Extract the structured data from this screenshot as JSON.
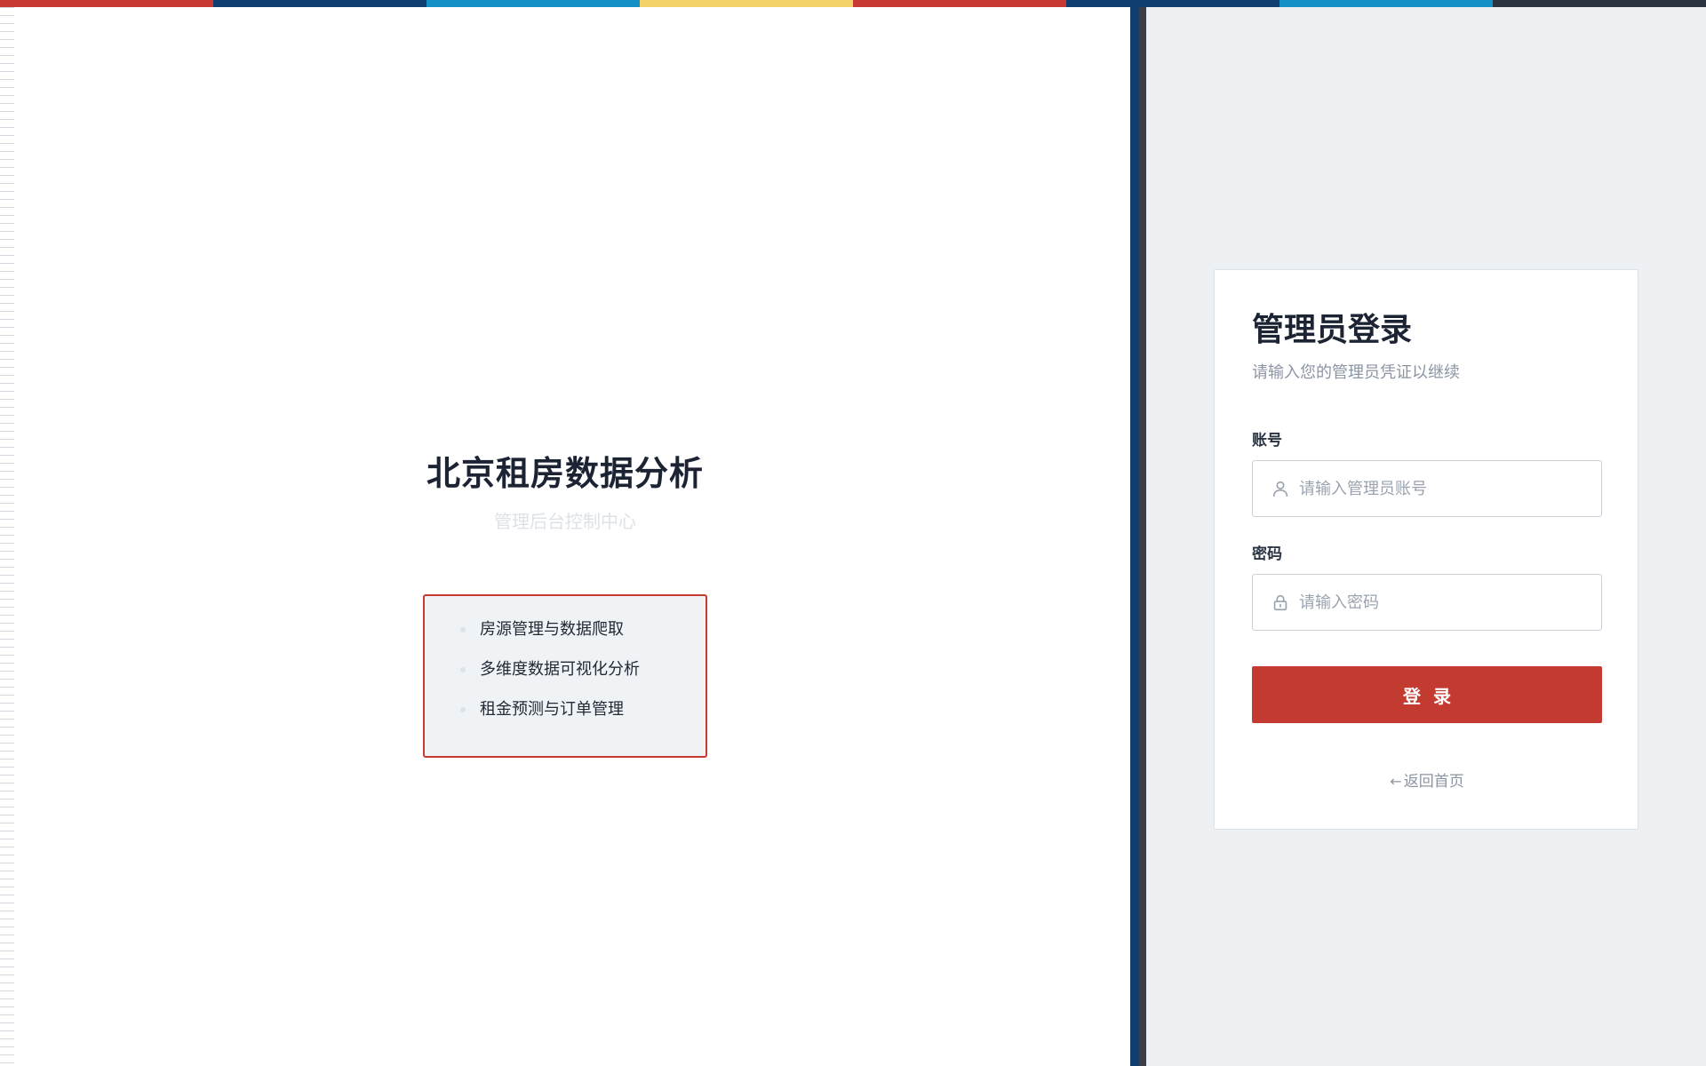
{
  "colors": {
    "stripe": [
      "#c83a31",
      "#0f3f70",
      "#1590c6",
      "#f3d26a",
      "#c83a31",
      "#0f3f70",
      "#1590c6",
      "#2a3440"
    ],
    "accent": "#c33a31",
    "divider": "#0f3f70",
    "right_bg": "#eef1f4"
  },
  "hero": {
    "title": "北京租房数据分析",
    "subtitle": "管理后台控制中心",
    "features": [
      "房源管理与数据爬取",
      "多维度数据可视化分析",
      "租金预测与订单管理"
    ]
  },
  "login": {
    "title": "管理员登录",
    "subtitle": "请输入您的管理员凭证以继续",
    "account": {
      "label": "账号",
      "placeholder": "请输入管理员账号",
      "icon": "user-icon"
    },
    "password": {
      "label": "密码",
      "placeholder": "请输入密码",
      "icon": "lock-icon"
    },
    "submit_label": "登录",
    "back": {
      "arrow": "←",
      "label": "返回首页"
    }
  }
}
